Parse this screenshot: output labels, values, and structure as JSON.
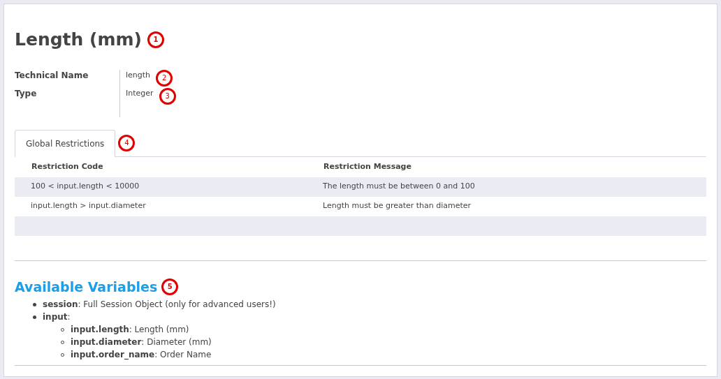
{
  "title": {
    "text": "Length (mm)",
    "marker": "1"
  },
  "properties": [
    {
      "label": "Technical Name",
      "value": "length",
      "marker": "2"
    },
    {
      "label": "Type",
      "value": "Integer",
      "marker": "3"
    }
  ],
  "tabs": [
    {
      "label": "Global Restrictions",
      "selected": true,
      "marker": "4"
    }
  ],
  "table": {
    "columns": [
      "Restriction Code",
      "Restriction Message"
    ],
    "rows": [
      [
        "100 < input.length < 10000",
        "The length must be between 0 and 100"
      ],
      [
        "input.length > input.diameter",
        "Length must be greater than diameter"
      ],
      []
    ]
  },
  "variables": {
    "title": "Available Variables",
    "marker": "5",
    "items": [
      {
        "text": "**session**: Full Session Object (only for advanced users!)"
      },
      {
        "text": "**input**:",
        "children": [
          {
            "text": "**input.length**: Length (mm)"
          },
          {
            "text": "**input.diameter**: Diameter (mm)"
          },
          {
            "text": "**input.order_name**: Order Name"
          }
        ]
      }
    ]
  }
}
